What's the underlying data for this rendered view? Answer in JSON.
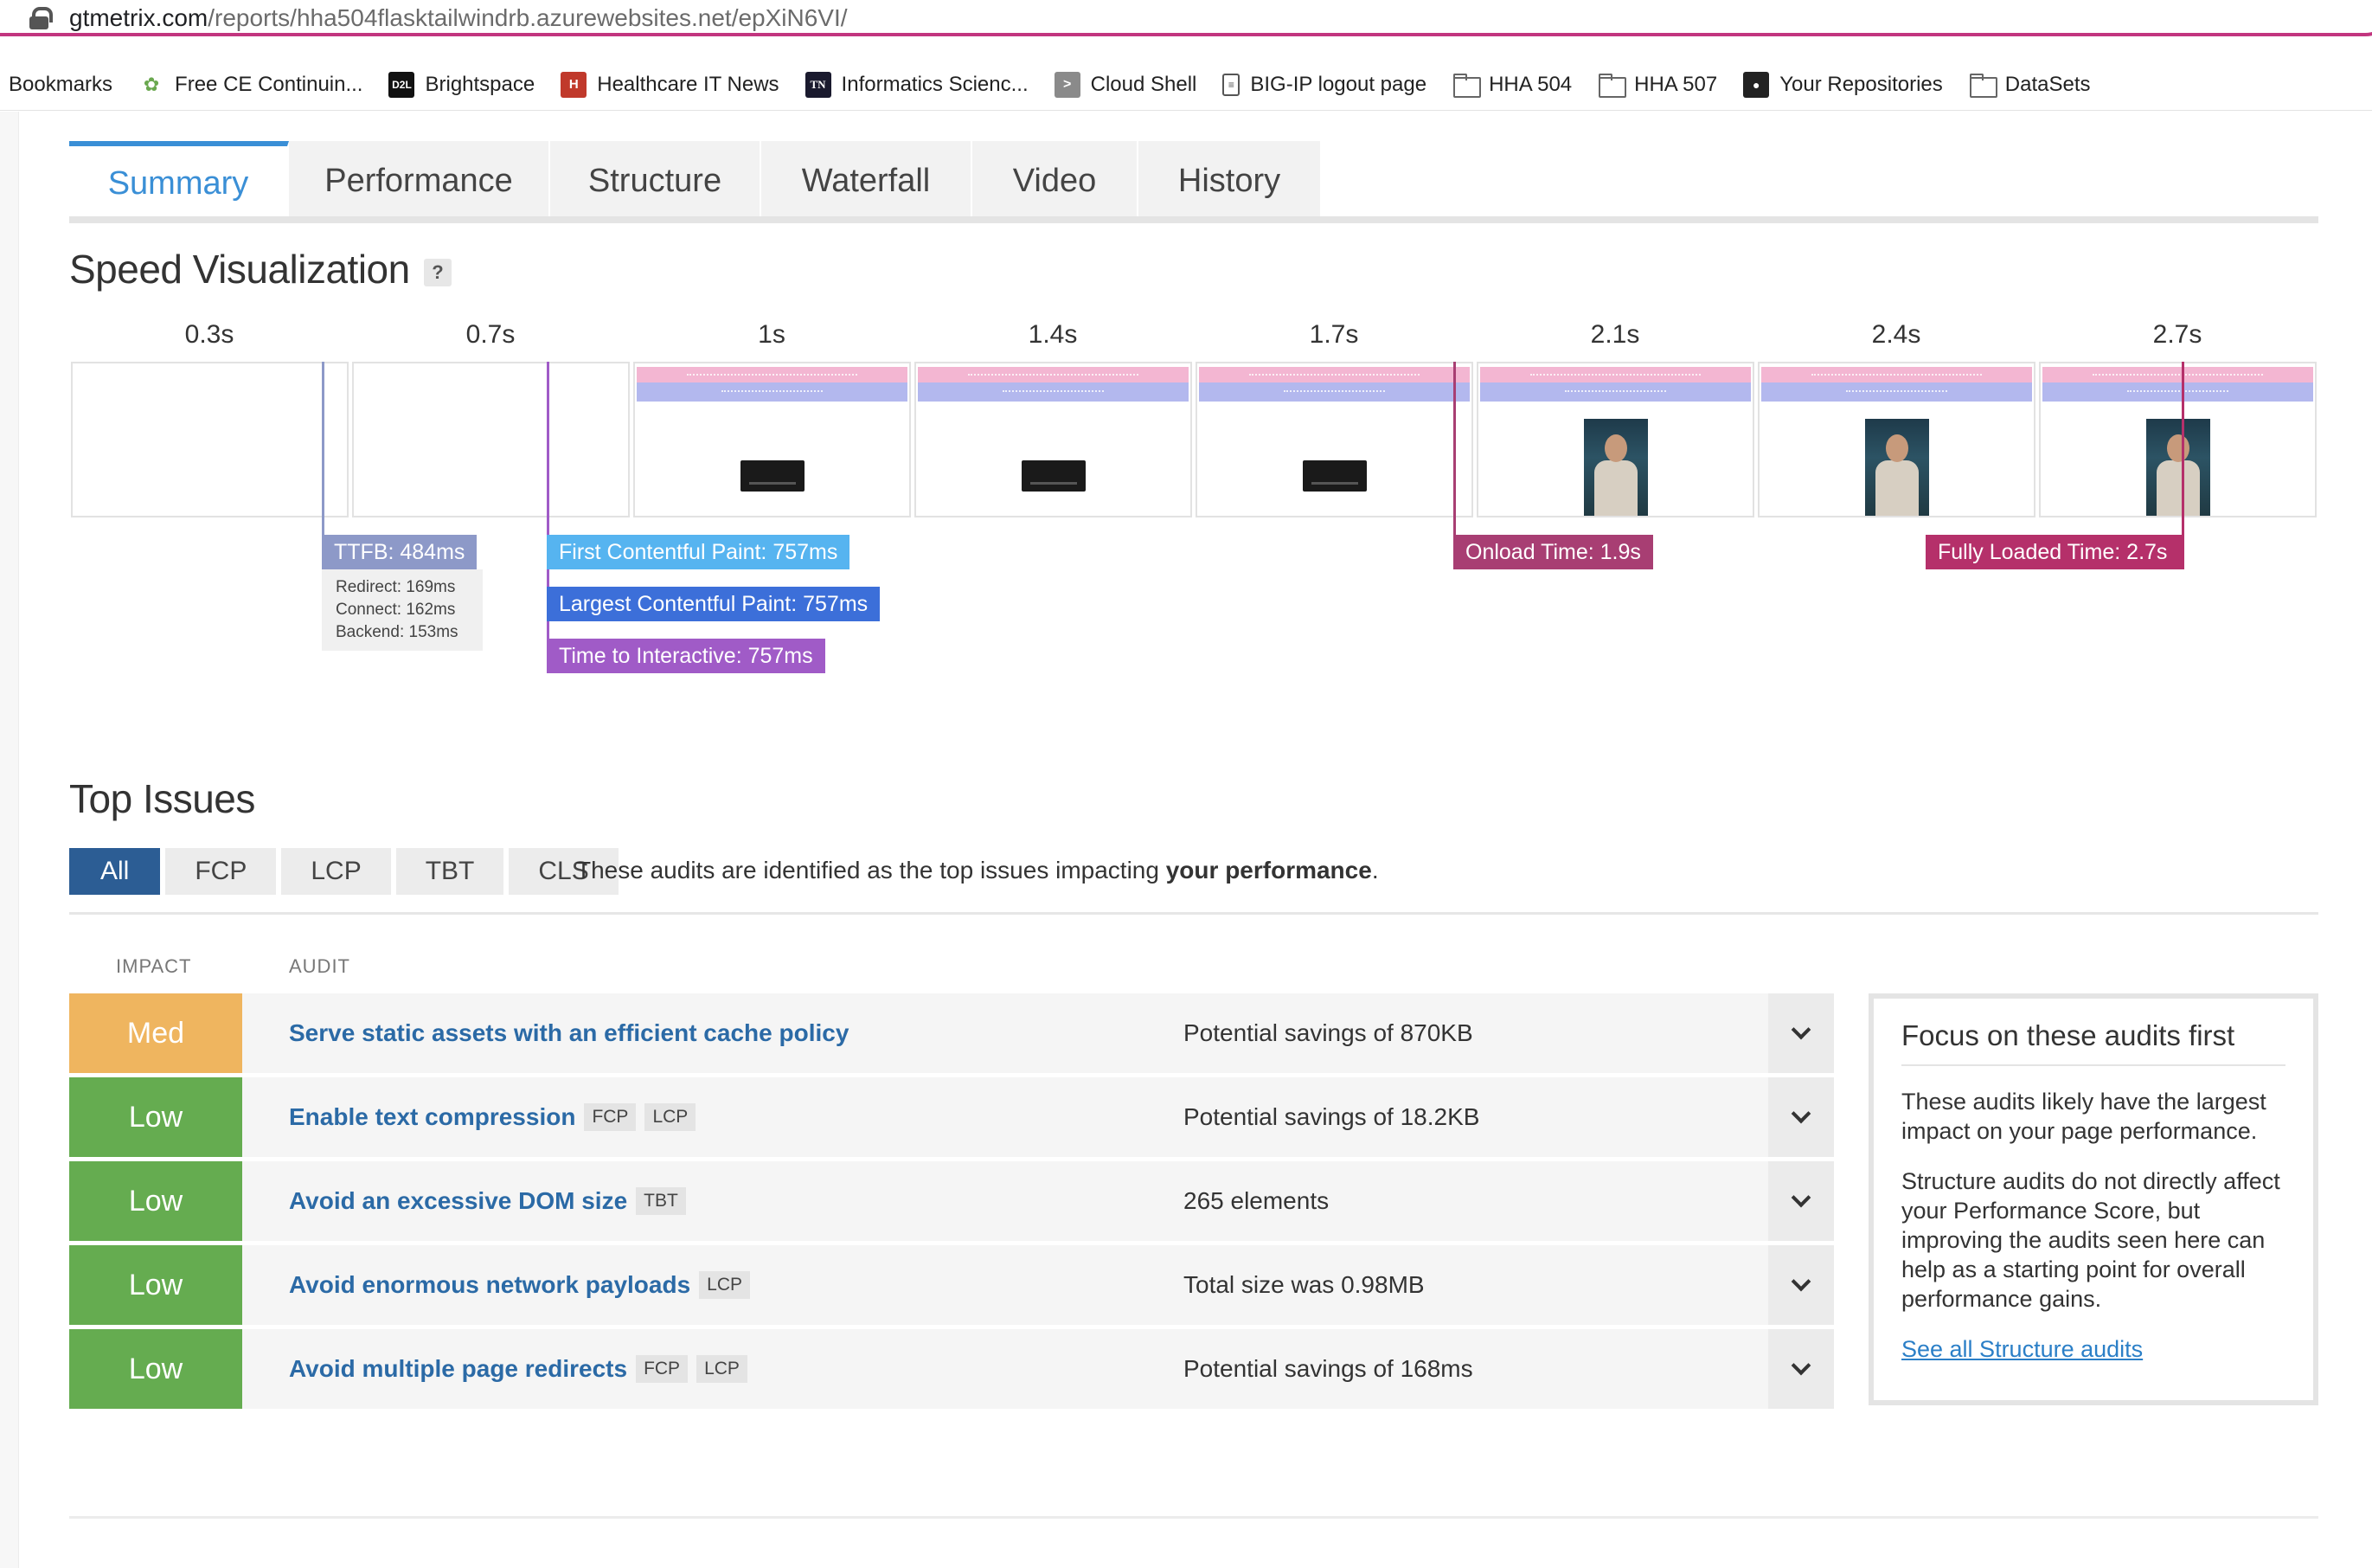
{
  "browser": {
    "url_domain": "gtmetrix.com",
    "url_path": "/reports/hha504flasktailwindrb.azurewebsites.net/epXiN6VI/",
    "bookmarks": [
      {
        "label": "Bookmarks",
        "icon": ""
      },
      {
        "label": "Free CE Continuin...",
        "icon": "leaf-icon"
      },
      {
        "label": "Brightspace",
        "icon": "d2l-icon"
      },
      {
        "label": "Healthcare IT News",
        "icon": "h-icon"
      },
      {
        "label": "Informatics Scienc...",
        "icon": "tn-icon"
      },
      {
        "label": "Cloud Shell",
        "icon": "cloud-shell-icon"
      },
      {
        "label": "BIG-IP logout page",
        "icon": "document-icon"
      },
      {
        "label": "HHA 504",
        "icon": "folder-icon"
      },
      {
        "label": "HHA 507",
        "icon": "folder-icon"
      },
      {
        "label": "Your Repositories",
        "icon": "github-icon"
      },
      {
        "label": "DataSets",
        "icon": "folder-icon"
      }
    ]
  },
  "tabs": [
    "Summary",
    "Performance",
    "Structure",
    "Waterfall",
    "Video",
    "History"
  ],
  "active_tab": "Summary",
  "speed": {
    "title": "Speed Visualization",
    "help": "?",
    "frames": [
      "0.3s",
      "0.7s",
      "1s",
      "1.4s",
      "1.7s",
      "2.1s",
      "2.4s",
      "2.7s"
    ],
    "markers": {
      "ttfb": "TTFB: 484ms",
      "redirect": "Redirect: 169ms",
      "connect": "Connect: 162ms",
      "backend": "Backend: 153ms",
      "fcp": "First Contentful Paint: 757ms",
      "lcp": "Largest Contentful Paint: 757ms",
      "tti": "Time to Interactive: 757ms",
      "onload": "Onload Time: 1.9s",
      "fully_loaded": "Fully Loaded Time: 2.7s"
    },
    "colors": {
      "ttfb": "#8d99c8",
      "fcp": "#56b4f0",
      "lcp": "#3c6fd9",
      "tti": "#a05bc7",
      "onload": "#a83e73",
      "fully_loaded": "#b5306a"
    }
  },
  "top_issues": {
    "title": "Top Issues",
    "filters": [
      "All",
      "FCP",
      "LCP",
      "TBT",
      "CLS"
    ],
    "active_filter": "All",
    "description_pre": "These audits are identified as the top issues impacting ",
    "description_bold": "your performance",
    "description_post": ".",
    "col_impact": "IMPACT",
    "col_audit": "AUDIT",
    "rows": [
      {
        "impact": "Med",
        "audit": "Serve static assets with an efficient cache policy",
        "tags": [],
        "savings": "Potential savings of 870KB"
      },
      {
        "impact": "Low",
        "audit": "Enable text compression",
        "tags": [
          "FCP",
          "LCP"
        ],
        "savings": "Potential savings of 18.2KB"
      },
      {
        "impact": "Low",
        "audit": "Avoid an excessive DOM size",
        "tags": [
          "TBT"
        ],
        "savings": "265 elements"
      },
      {
        "impact": "Low",
        "audit": "Avoid enormous network payloads",
        "tags": [
          "LCP"
        ],
        "savings": "Total size was 0.98MB"
      },
      {
        "impact": "Low",
        "audit": "Avoid multiple page redirects",
        "tags": [
          "FCP",
          "LCP"
        ],
        "savings": "Potential savings of 168ms"
      }
    ]
  },
  "focus": {
    "title": "Focus on these audits first",
    "p1": "These audits likely have the largest impact on your page performance.",
    "p2": "Structure audits do not directly affect your Performance Score, but improving the audits seen here can help as a starting point for overall performance gains.",
    "link": "See all Structure audits"
  }
}
